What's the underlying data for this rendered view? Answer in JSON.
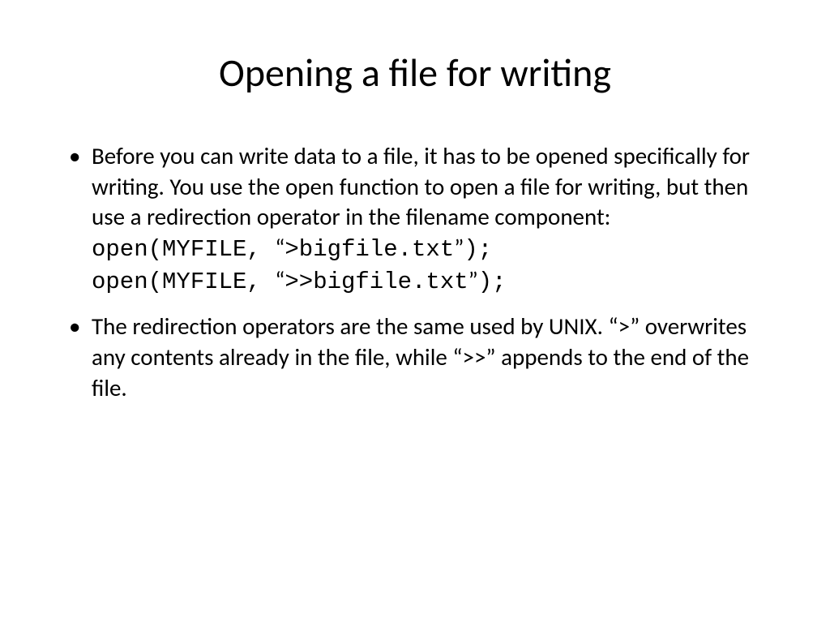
{
  "slide": {
    "title": "Opening a file for writing",
    "bullets": [
      {
        "text": "Before you can write data to a file, it has to be opened specifically for writing.  You use the open function to open a file for writing, but then use a redirection operator in the filename component:",
        "code": [
          {
            "prefix": "open(MYFILE, ",
            "q1": "“",
            "inner": ">bigfile.txt",
            "q2": "”",
            "suffix": ");"
          },
          {
            "prefix": "open(MYFILE, ",
            "q1": "“",
            "inner": ">>bigfile.txt",
            "q2": "”",
            "suffix": ");"
          }
        ]
      },
      {
        "parts": {
          "p1": "The redirection operators are the same used by UNIX. ",
          "q1a": "“",
          "op1": ">",
          "q1b": "”",
          "p2": " overwrites any contents already in the file, while ",
          "q2a": "“",
          "op2": ">>",
          "q2b": "”",
          "p3": " appends to the end of the file."
        }
      }
    ]
  }
}
